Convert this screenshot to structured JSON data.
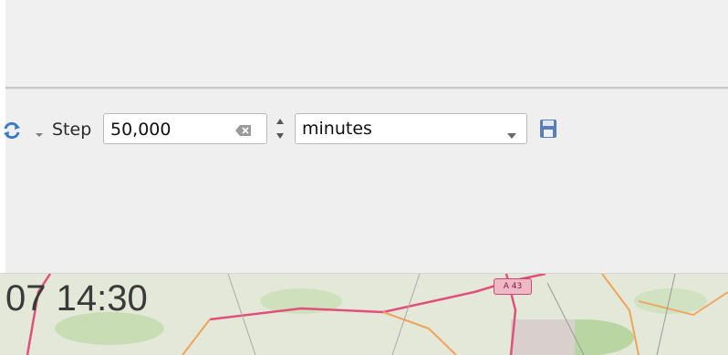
{
  "toolbar": {
    "step_label": "Step",
    "step_value": "50,000",
    "unit_value": "minutes"
  },
  "map": {
    "time_text": "07 14:30",
    "road_label": "A 43"
  },
  "colors": {
    "refresh_icon": "#3a7cc4",
    "save_icon": "#5a7fb5",
    "road_major": "#e0507a",
    "road_minor": "#f0a35a"
  },
  "icons": [
    "refresh-icon",
    "chevron-down-icon",
    "clear-text-icon",
    "spin-up-icon",
    "spin-down-icon",
    "save-icon"
  ]
}
